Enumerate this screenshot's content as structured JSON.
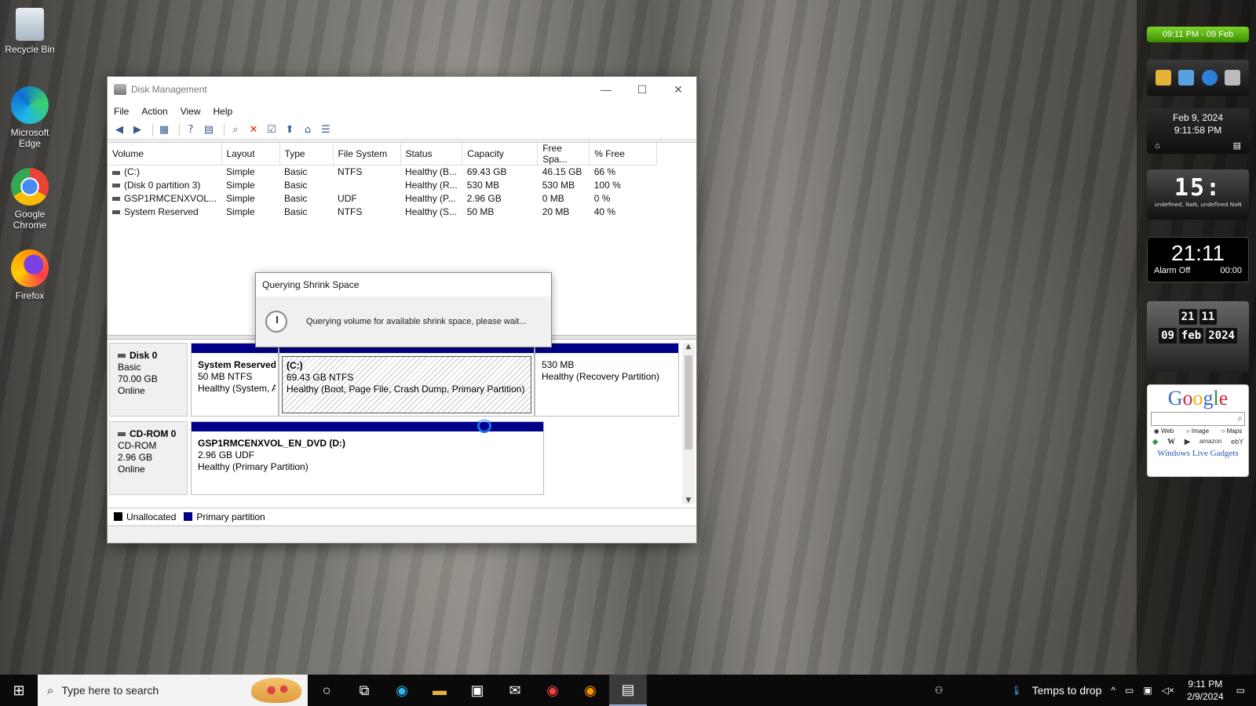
{
  "desktop": {
    "icons": [
      {
        "label": "Recycle Bin"
      },
      {
        "label": "Microsoft Edge"
      },
      {
        "label": "Google Chrome"
      },
      {
        "label": "Firefox"
      }
    ]
  },
  "window": {
    "title": "Disk Management",
    "menu": [
      "File",
      "Action",
      "View",
      "Help"
    ],
    "columns": [
      "Volume",
      "Layout",
      "Type",
      "File System",
      "Status",
      "Capacity",
      "Free Spa...",
      "% Free"
    ],
    "volumes": [
      [
        "(C:)",
        "Simple",
        "Basic",
        "NTFS",
        "Healthy (B...",
        "69.43 GB",
        "46.15 GB",
        "66 %"
      ],
      [
        "(Disk 0 partition 3)",
        "Simple",
        "Basic",
        "",
        "Healthy (R...",
        "530 MB",
        "530 MB",
        "100 %"
      ],
      [
        "GSP1RMCENXVOL...",
        "Simple",
        "Basic",
        "UDF",
        "Healthy (P...",
        "2.96 GB",
        "0 MB",
        "0 %"
      ],
      [
        "System Reserved",
        "Simple",
        "Basic",
        "NTFS",
        "Healthy (S...",
        "50 MB",
        "20 MB",
        "40 %"
      ]
    ],
    "disk0": {
      "name": "Disk 0",
      "type": "Basic",
      "size": "70.00 GB",
      "state": "Online",
      "partitions": [
        {
          "title": "System Reserved",
          "line2": "50 MB NTFS",
          "line3": "Healthy (System, A"
        },
        {
          "title": "(C:)",
          "line2": "69.43 GB NTFS",
          "line3": "Healthy (Boot, Page File, Crash Dump, Primary Partition)"
        },
        {
          "title": "",
          "line2": "530 MB",
          "line3": "Healthy (Recovery Partition)"
        }
      ]
    },
    "cdrom0": {
      "name": "CD-ROM 0",
      "type": "CD-ROM",
      "size": "2.96 GB",
      "state": "Online",
      "partition": {
        "title": "GSP1RMCENXVOL_EN_DVD  (D:)",
        "line2": "2.96 GB UDF",
        "line3": "Healthy (Primary Partition)"
      }
    },
    "legend": {
      "unallocated": "Unallocated",
      "primary": "Primary partition",
      "unallocated_color": "#000000",
      "primary_color": "#00008a"
    }
  },
  "dialog": {
    "title": "Querying Shrink Space",
    "message": "Querying volume for available shrink space, please wait..."
  },
  "gadgets": {
    "green_clock": "09:11 PM - 09 Feb",
    "date": "Feb 9, 2024",
    "time": "9:11:58 PM",
    "led_time": "15:",
    "led_sub": "undefined, NaN, undefined NaN",
    "alarm_time": "21:11",
    "alarm_label": "Alarm Off",
    "alarm_countdown": "00:00",
    "flip_hour": "21",
    "flip_min": "11",
    "flip_day": "09",
    "flip_month": "feb",
    "flip_year": "2024",
    "google_opts": [
      "Web",
      "Image",
      "Maps"
    ],
    "google_footer": "Windows Live Gadgets"
  },
  "taskbar": {
    "search_placeholder": "Type here to search",
    "weather": "Temps to drop",
    "time": "9:11 PM",
    "date": "2/9/2024"
  }
}
